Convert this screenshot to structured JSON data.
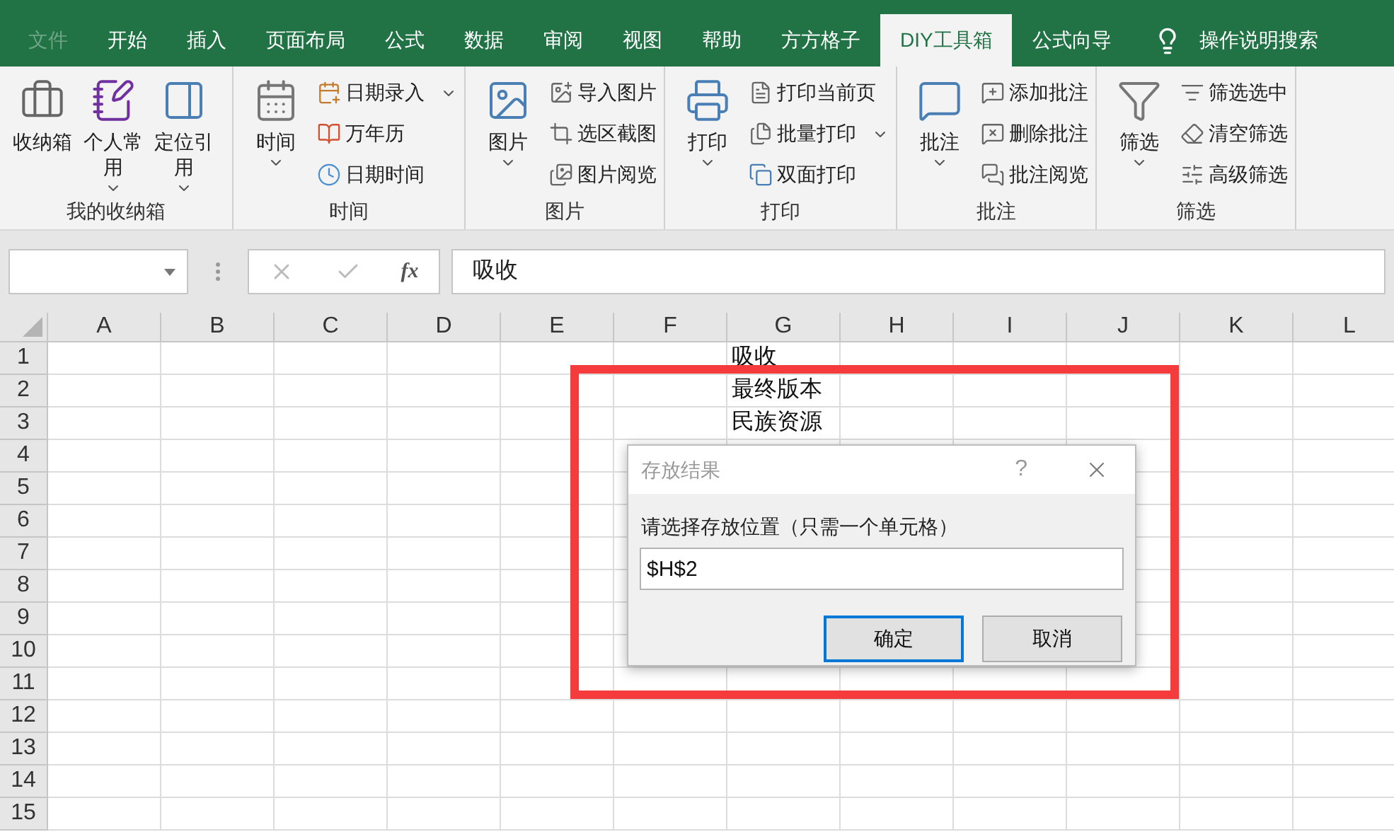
{
  "tabs": [
    {
      "label": "文件",
      "selected": false,
      "kind": "file"
    },
    {
      "label": "开始",
      "selected": false,
      "kind": "tab"
    },
    {
      "label": "插入",
      "selected": false,
      "kind": "tab"
    },
    {
      "label": "页面布局",
      "selected": false,
      "kind": "tab"
    },
    {
      "label": "公式",
      "selected": false,
      "kind": "tab"
    },
    {
      "label": "数据",
      "selected": false,
      "kind": "tab"
    },
    {
      "label": "审阅",
      "selected": false,
      "kind": "tab"
    },
    {
      "label": "视图",
      "selected": false,
      "kind": "tab"
    },
    {
      "label": "帮助",
      "selected": false,
      "kind": "tab"
    },
    {
      "label": "方方格子",
      "selected": false,
      "kind": "tab"
    },
    {
      "label": "DIY工具箱",
      "selected": true,
      "kind": "tab"
    },
    {
      "label": "公式向导",
      "selected": false,
      "kind": "tab"
    }
  ],
  "search": {
    "label": "操作说明搜索"
  },
  "ribbon_groups": [
    {
      "label": "我的收纳箱",
      "items": [
        {
          "kind": "large",
          "label": "收纳箱",
          "dropdown": false
        },
        {
          "kind": "large",
          "label": "个人常用",
          "dropdown": true
        },
        {
          "kind": "large",
          "label": "定位引用",
          "dropdown": true
        }
      ]
    },
    {
      "label": "时间",
      "items": [
        {
          "kind": "large",
          "label": "时间",
          "dropdown": true
        },
        {
          "kind": "small",
          "label": "日期录入",
          "dropdown": true
        },
        {
          "kind": "small",
          "label": "万年历",
          "dropdown": false
        },
        {
          "kind": "small",
          "label": "日期时间",
          "dropdown": false
        }
      ]
    },
    {
      "label": "图片",
      "items": [
        {
          "kind": "large",
          "label": "图片",
          "dropdown": true
        },
        {
          "kind": "small",
          "label": "导入图片",
          "dropdown": false
        },
        {
          "kind": "small",
          "label": "选区截图",
          "dropdown": false
        },
        {
          "kind": "small",
          "label": "图片阅览",
          "dropdown": false
        }
      ]
    },
    {
      "label": "打印",
      "items": [
        {
          "kind": "large",
          "label": "打印",
          "dropdown": true
        },
        {
          "kind": "small",
          "label": "打印当前页",
          "dropdown": false
        },
        {
          "kind": "small",
          "label": "批量打印",
          "dropdown": true
        },
        {
          "kind": "small",
          "label": "双面打印",
          "dropdown": false
        }
      ]
    },
    {
      "label": "批注",
      "items": [
        {
          "kind": "large",
          "label": "批注",
          "dropdown": true
        },
        {
          "kind": "small",
          "label": "添加批注",
          "dropdown": false
        },
        {
          "kind": "small",
          "label": "删除批注",
          "dropdown": false
        },
        {
          "kind": "small",
          "label": "批注阅览",
          "dropdown": false
        }
      ]
    },
    {
      "label": "筛选",
      "items": [
        {
          "kind": "large",
          "label": "筛选",
          "dropdown": true
        },
        {
          "kind": "small",
          "label": "筛选选中",
          "dropdown": false
        },
        {
          "kind": "small",
          "label": "清空筛选",
          "dropdown": false
        },
        {
          "kind": "small",
          "label": "高级筛选",
          "dropdown": false
        }
      ]
    }
  ],
  "formula_bar": {
    "function_label": "fx",
    "value": "吸收"
  },
  "sheet": {
    "columns": [
      {
        "label": "A"
      },
      {
        "label": "B"
      },
      {
        "label": "C"
      },
      {
        "label": "D"
      },
      {
        "label": "E"
      },
      {
        "label": "F"
      },
      {
        "label": "G",
        "entries": [
          "吸收",
          "最终版本",
          "民族资源"
        ]
      },
      {
        "label": "H"
      },
      {
        "label": "I"
      },
      {
        "label": "J"
      },
      {
        "label": "K"
      },
      {
        "label": "L"
      }
    ],
    "rows": [
      "1",
      "2",
      "3",
      "4",
      "5",
      "6",
      "7",
      "8",
      "9",
      "10",
      "11",
      "12",
      "13",
      "14",
      "15"
    ]
  },
  "dialog": {
    "title": "存放结果",
    "help": "?",
    "prompt": "请选择存放位置（只需一个单元格）",
    "value": "$H$2",
    "buttons": [
      {
        "label": "确定",
        "default": true
      },
      {
        "label": "取消",
        "default": false
      }
    ]
  }
}
